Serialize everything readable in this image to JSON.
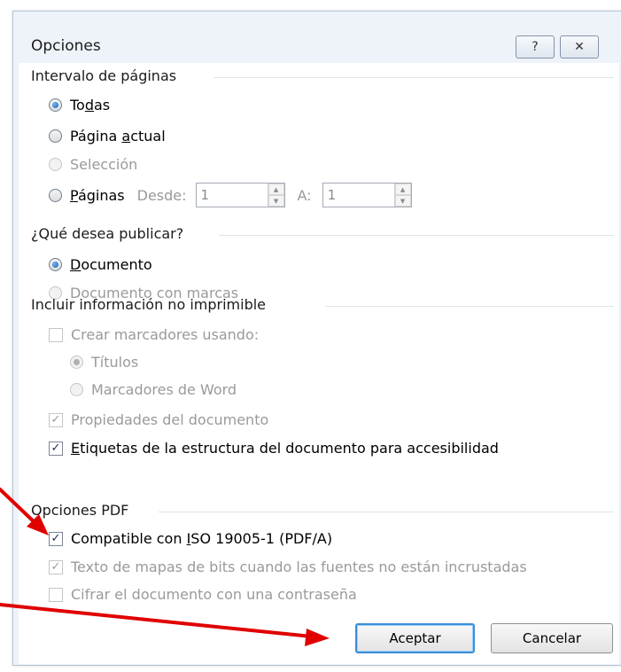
{
  "dialog": {
    "title": "Opciones",
    "help_glyph": "?",
    "close_glyph": "✕"
  },
  "page_range": {
    "heading": "Intervalo de páginas",
    "all_prefix": "To",
    "all_hot": "d",
    "all_suffix": "as",
    "current_prefix": "Página ",
    "current_hot": "a",
    "current_suffix": "ctual",
    "selection": "Selección",
    "pages_hot": "P",
    "pages_suffix": "áginas",
    "from_label": "Desde:",
    "from_value": "1",
    "to_label": "A:",
    "to_value": "1",
    "selected": "all"
  },
  "publish": {
    "heading": "¿Qué desea publicar?",
    "document_hot": "D",
    "document_suffix": "ocumento",
    "document_markup": "Documento con marcas",
    "selected": "document"
  },
  "nonprint": {
    "heading": "Incluir información no imprimible",
    "bookmarks": "Crear marcadores usando:",
    "headings": "Títulos",
    "word_bookmarks": "Marcadores de Word",
    "properties": "Propiedades del documento",
    "tags_hot": "E",
    "tags_suffix": "tiquetas de la estructura del documento para accesibilidad"
  },
  "pdf": {
    "heading": "Opciones PDF",
    "iso_prefix": "Compatible con ",
    "iso_hot": "I",
    "iso_suffix": "SO 19005-1 (PDF/A)",
    "bitmap": "Texto de mapas de bits cuando las fuentes no están incrustadas",
    "encrypt": "Cifrar el documento con una contraseña"
  },
  "buttons": {
    "ok": "Aceptar",
    "cancel": "Cancelar"
  },
  "colors": {
    "annotation_arrow": "#e00000",
    "default_button_border": "#3b8ed8"
  }
}
